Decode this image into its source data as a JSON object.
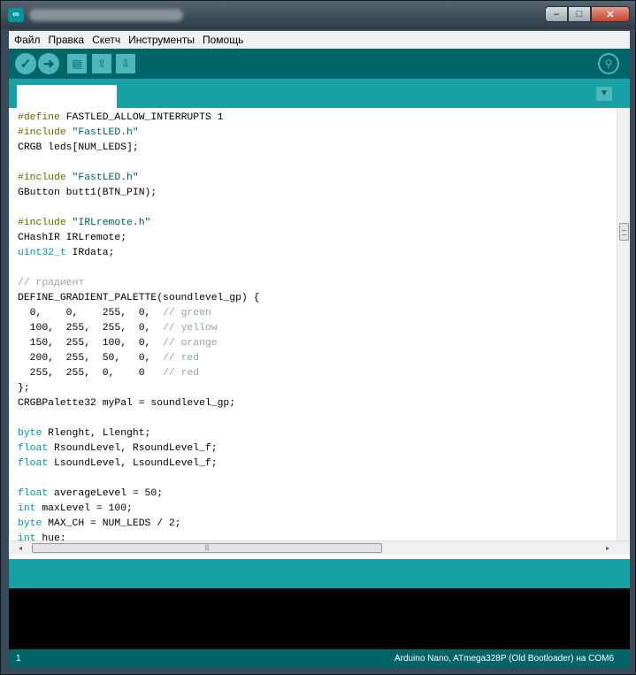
{
  "menu": {
    "items": [
      "Файл",
      "Правка",
      "Скетч",
      "Инструменты",
      "Помощь"
    ]
  },
  "window": {
    "minimize_glyph": "–",
    "maximize_glyph": "□",
    "close_glyph": "✕"
  },
  "toolbar": {
    "icons": [
      "check-icon",
      "arrow-right-icon",
      "new-file-icon",
      "open-arrow-up-icon",
      "save-arrow-down-icon",
      "magnifier-icon"
    ]
  },
  "colors": {
    "teal_dark": "#006468",
    "teal": "#17a1a5",
    "teal_light": "#4db7bb",
    "preprocessor": "#5e6d03",
    "string": "#005c5f",
    "type": "#00979c",
    "comment": "#95a5a6"
  },
  "editor": {
    "lines": [
      [
        [
          "pre",
          "#define"
        ],
        [
          "",
          " FASTLED_ALLOW_INTERRUPTS 1"
        ]
      ],
      [
        [
          "pre",
          "#include"
        ],
        [
          "",
          " "
        ],
        [
          "str",
          "\"FastLED.h\""
        ]
      ],
      [
        [
          "",
          "CRGB leds[NUM_LEDS];"
        ]
      ],
      [
        [
          "",
          ""
        ]
      ],
      [
        [
          "pre",
          "#include"
        ],
        [
          "",
          " "
        ],
        [
          "str",
          "\"FastLED.h\""
        ]
      ],
      [
        [
          "",
          "GButton butt1(BTN_PIN);"
        ]
      ],
      [
        [
          "",
          ""
        ]
      ],
      [
        [
          "pre",
          "#include"
        ],
        [
          "",
          " "
        ],
        [
          "str",
          "\"IRLremote.h\""
        ]
      ],
      [
        [
          "",
          "CHashIR IRLremote;"
        ]
      ],
      [
        [
          "type",
          "uint32_t"
        ],
        [
          "",
          " IRdata;"
        ]
      ],
      [
        [
          "",
          ""
        ]
      ],
      [
        [
          "cm",
          "// градиент"
        ]
      ],
      [
        [
          "",
          "DEFINE_GRADIENT_PALETTE(soundlevel_gp) {"
        ]
      ],
      [
        [
          "",
          "  0,    0,    255,  0,  "
        ],
        [
          "cm",
          "// green"
        ]
      ],
      [
        [
          "",
          "  100,  255,  255,  0,  "
        ],
        [
          "cm",
          "// yellow"
        ]
      ],
      [
        [
          "",
          "  150,  255,  100,  0,  "
        ],
        [
          "cm",
          "// orange"
        ]
      ],
      [
        [
          "",
          "  200,  255,  50,   0,  "
        ],
        [
          "cm",
          "// red"
        ]
      ],
      [
        [
          "",
          "  255,  255,  0,    0   "
        ],
        [
          "cm",
          "// red"
        ]
      ],
      [
        [
          "",
          "};"
        ]
      ],
      [
        [
          "",
          "CRGBPalette32 myPal = soundlevel_gp;"
        ]
      ],
      [
        [
          "",
          ""
        ]
      ],
      [
        [
          "type",
          "byte"
        ],
        [
          "",
          " Rlenght, Llenght;"
        ]
      ],
      [
        [
          "type",
          "float"
        ],
        [
          "",
          " RsoundLevel, RsoundLevel_f;"
        ]
      ],
      [
        [
          "type",
          "float"
        ],
        [
          "",
          " LsoundLevel, LsoundLevel_f;"
        ]
      ],
      [
        [
          "",
          ""
        ]
      ],
      [
        [
          "type",
          "float"
        ],
        [
          "",
          " averageLevel = 50;"
        ]
      ],
      [
        [
          "type",
          "int"
        ],
        [
          "",
          " maxLevel = 100;"
        ]
      ],
      [
        [
          "type",
          "byte"
        ],
        [
          "",
          " MAX_CH = NUM_LEDS / 2;"
        ]
      ],
      [
        [
          "type",
          "int"
        ],
        [
          "",
          " hue;"
        ]
      ]
    ]
  },
  "scrollbar": {
    "left_arrow": "◂",
    "right_arrow": "▸",
    "grip": "|||"
  },
  "footer": {
    "line_number": "1",
    "board": "Arduino Nano, ATmega328P (Old Bootloader) на COM6"
  }
}
